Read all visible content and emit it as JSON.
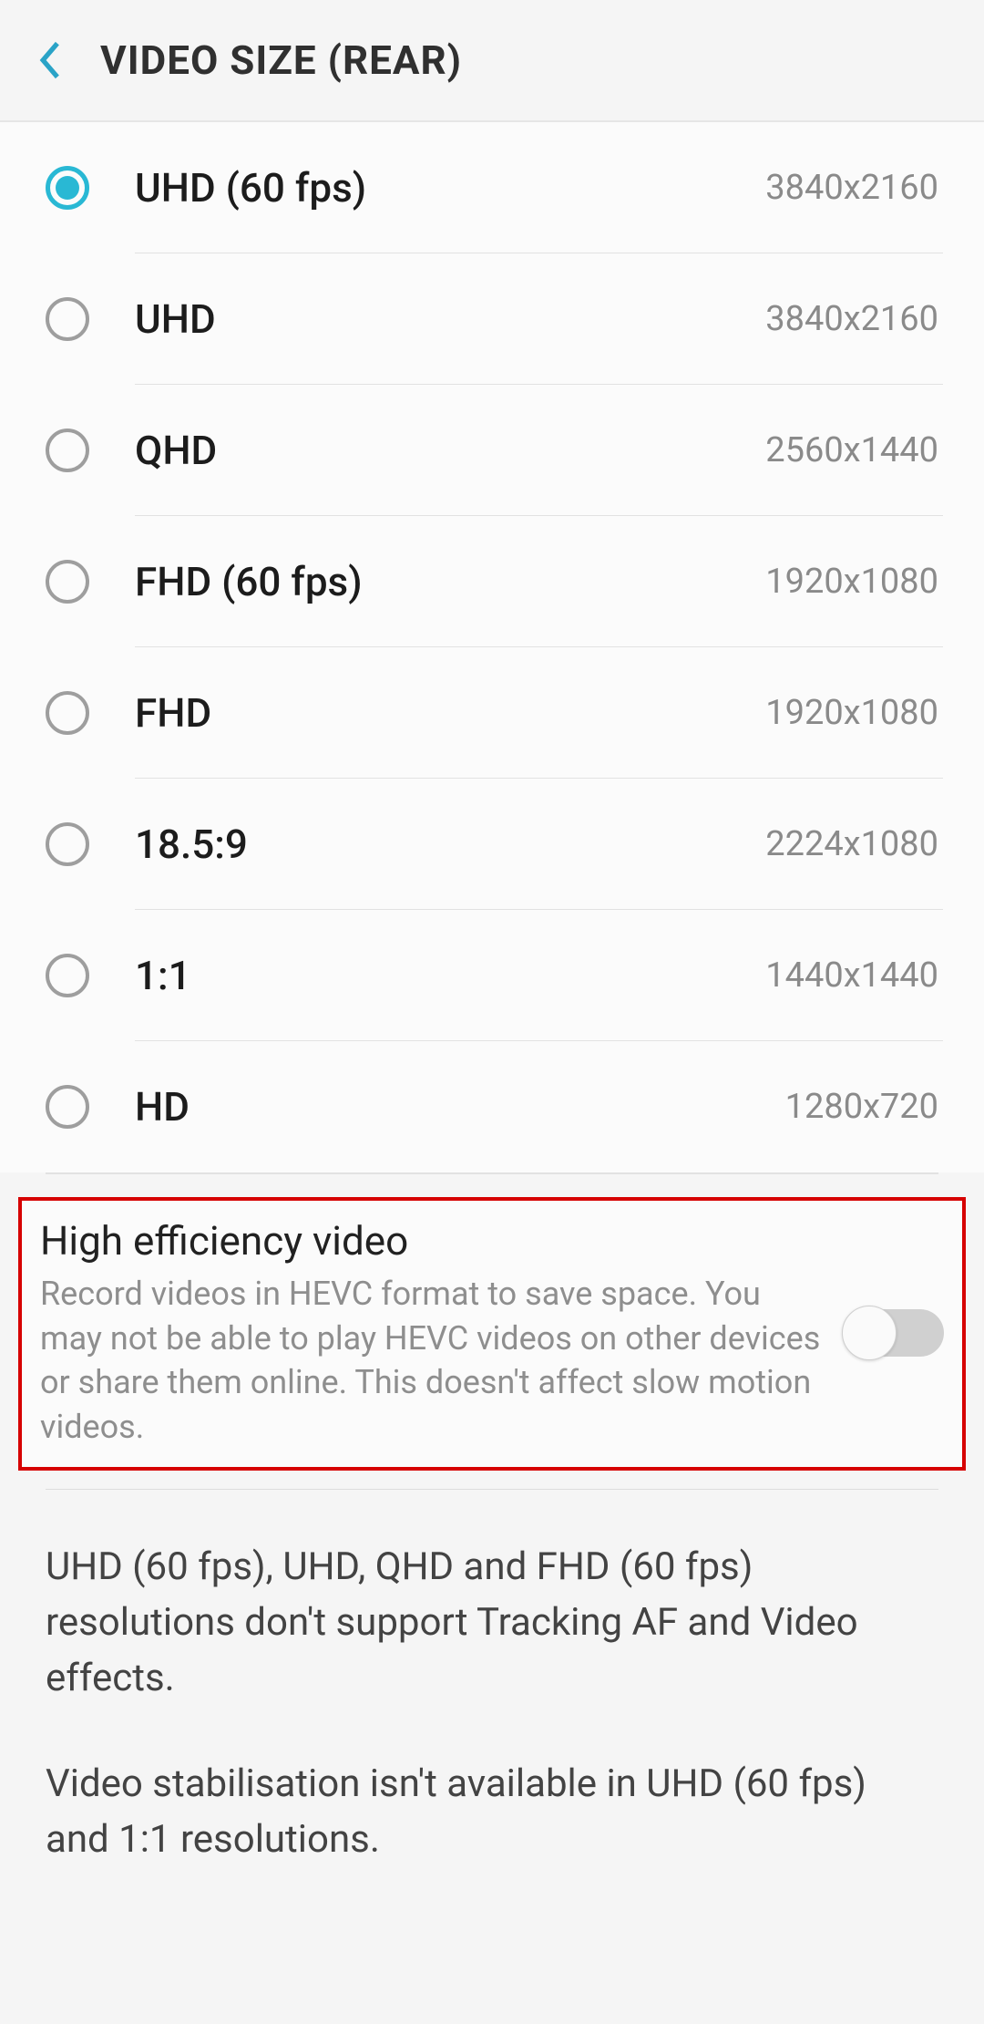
{
  "header": {
    "title": "VIDEO SIZE (REAR)"
  },
  "options": [
    {
      "label": "UHD (60 fps)",
      "resolution": "3840x2160",
      "selected": true
    },
    {
      "label": "UHD",
      "resolution": "3840x2160",
      "selected": false
    },
    {
      "label": "QHD",
      "resolution": "2560x1440",
      "selected": false
    },
    {
      "label": "FHD (60 fps)",
      "resolution": "1920x1080",
      "selected": false
    },
    {
      "label": "FHD",
      "resolution": "1920x1080",
      "selected": false
    },
    {
      "label": "18.5:9",
      "resolution": "2224x1080",
      "selected": false
    },
    {
      "label": "1:1",
      "resolution": "1440x1440",
      "selected": false
    },
    {
      "label": "HD",
      "resolution": "1280x720",
      "selected": false
    }
  ],
  "hevc": {
    "title": "High efficiency video",
    "description": "Record videos in HEVC format to save space. You may not be able to play HEVC videos on other devices or share them online. This doesn't affect slow motion videos.",
    "enabled": false
  },
  "info": {
    "p1": "UHD (60 fps), UHD, QHD and FHD (60 fps) resolutions don't support Tracking AF and Video effects.",
    "p2": "Video stabilisation isn't available in UHD (60 fps) and 1:1 resolutions."
  }
}
